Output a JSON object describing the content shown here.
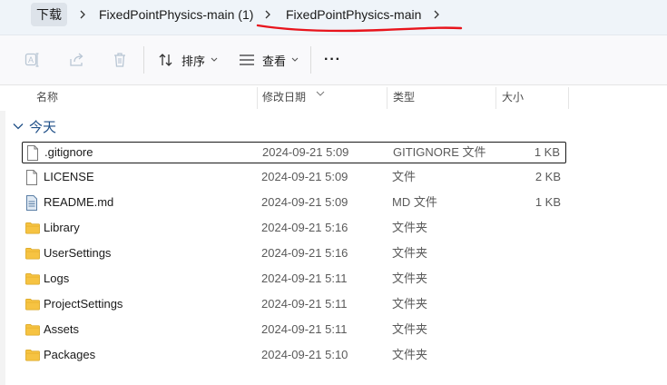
{
  "breadcrumb": {
    "items": [
      {
        "label": "下载"
      },
      {
        "label": "FixedPointPhysics-main (1)"
      },
      {
        "label": "FixedPointPhysics-main"
      }
    ]
  },
  "toolbar": {
    "sort_label": "排序",
    "view_label": "查看",
    "more_label": "···"
  },
  "columns": {
    "name": "名称",
    "date": "修改日期",
    "type": "类型",
    "size": "大小"
  },
  "group": {
    "label": "今天"
  },
  "files": [
    {
      "name": ".gitignore",
      "date": "2024-09-21 5:09",
      "type": "GITIGNORE 文件",
      "size": "1 KB",
      "icon": "file-icon"
    },
    {
      "name": "LICENSE",
      "date": "2024-09-21 5:09",
      "type": "文件",
      "size": "2 KB",
      "icon": "file-icon"
    },
    {
      "name": "README.md",
      "date": "2024-09-21 5:09",
      "type": "MD 文件",
      "size": "1 KB",
      "icon": "text-file-icon"
    },
    {
      "name": "Library",
      "date": "2024-09-21 5:16",
      "type": "文件夹",
      "size": "",
      "icon": "folder-icon"
    },
    {
      "name": "UserSettings",
      "date": "2024-09-21 5:16",
      "type": "文件夹",
      "size": "",
      "icon": "folder-icon"
    },
    {
      "name": "Logs",
      "date": "2024-09-21 5:11",
      "type": "文件夹",
      "size": "",
      "icon": "folder-icon"
    },
    {
      "name": "ProjectSettings",
      "date": "2024-09-21 5:11",
      "type": "文件夹",
      "size": "",
      "icon": "folder-icon"
    },
    {
      "name": "Assets",
      "date": "2024-09-21 5:11",
      "type": "文件夹",
      "size": "",
      "icon": "folder-icon"
    },
    {
      "name": "Packages",
      "date": "2024-09-21 5:10",
      "type": "文件夹",
      "size": "",
      "icon": "folder-icon"
    }
  ],
  "colors": {
    "accent": "#1f4f87",
    "annotation": "#e8141c",
    "folder": "#f6c342"
  }
}
